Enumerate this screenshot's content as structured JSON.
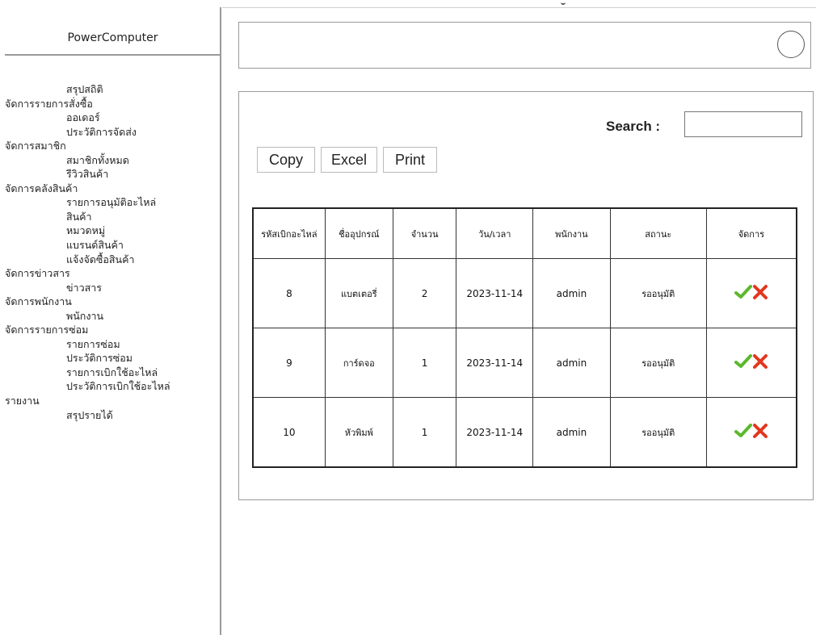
{
  "app": {
    "title": "PowerComputer"
  },
  "sidebar": {
    "items": [
      {
        "label": "สรุปสถิติ",
        "level": "sub"
      },
      {
        "label": "จัดการรายการสั่งซื้อ",
        "level": "group"
      },
      {
        "label": "ออเดอร์",
        "level": "sub"
      },
      {
        "label": "ประวัติการจัดส่ง",
        "level": "sub"
      },
      {
        "label": "จัดการสมาชิก",
        "level": "group"
      },
      {
        "label": "สมาชิกทั้งหมด",
        "level": "sub"
      },
      {
        "label": "รีวิวสินค้า",
        "level": "sub"
      },
      {
        "label": "จัดการคลังสินค้า",
        "level": "group"
      },
      {
        "label": "รายการอนุมัติอะไหล่",
        "level": "sub"
      },
      {
        "label": "สินค้า",
        "level": "sub"
      },
      {
        "label": "หมวดหมู่",
        "level": "sub"
      },
      {
        "label": "แบรนด์สินค้า",
        "level": "sub"
      },
      {
        "label": "แจ้งจัดซื้อสินค้า",
        "level": "sub"
      },
      {
        "label": "จัดการข่าวสาร",
        "level": "group"
      },
      {
        "label": "ข่าวสาร",
        "level": "sub"
      },
      {
        "label": "จัดการพนักงาน",
        "level": "group"
      },
      {
        "label": "พนักงาน",
        "level": "sub"
      },
      {
        "label": "จัดการรายการซ่อม",
        "level": "group"
      },
      {
        "label": "รายการซ่อม",
        "level": "sub"
      },
      {
        "label": "ประวัติการซ่อม",
        "level": "sub"
      },
      {
        "label": "รายการเบิกใช้อะไหล่",
        "level": "sub"
      },
      {
        "label": "ประวัติการเบิกใช้อะไหล่",
        "level": "sub"
      },
      {
        "label": "รายงาน",
        "level": "group"
      },
      {
        "label": "สรุปรายได้",
        "level": "sub"
      }
    ]
  },
  "header": {
    "avatar_icon": "user-avatar-circle-icon"
  },
  "toolbar": {
    "search_label": "Search :",
    "search_value": "",
    "copy_label": "Copy",
    "excel_label": "Excel",
    "print_label": "Print"
  },
  "table": {
    "columns": [
      "รหัสเบิกอะไหล่",
      "ชื่ออุปกรณ์",
      "จำนวน",
      "วัน/เวลา",
      "พนักงาน",
      "สถานะ",
      "จัดการ"
    ],
    "rows": [
      {
        "id": "8",
        "device": "แบตเตอรี่",
        "qty": "2",
        "datetime": "2023-11-14",
        "staff": "admin",
        "status": "รออนุมัติ"
      },
      {
        "id": "9",
        "device": "การ์ดจอ",
        "qty": "1",
        "datetime": "2023-11-14",
        "staff": "admin",
        "status": "รออนุมัติ"
      },
      {
        "id": "10",
        "device": "หัวพิมพ์",
        "qty": "1",
        "datetime": "2023-11-14",
        "staff": "admin",
        "status": "รออนุมัติ"
      }
    ],
    "actions": {
      "approve_icon": "check-icon",
      "reject_icon": "x-icon",
      "approve_color": "#5cb82d",
      "reject_color": "#e2371f"
    }
  }
}
